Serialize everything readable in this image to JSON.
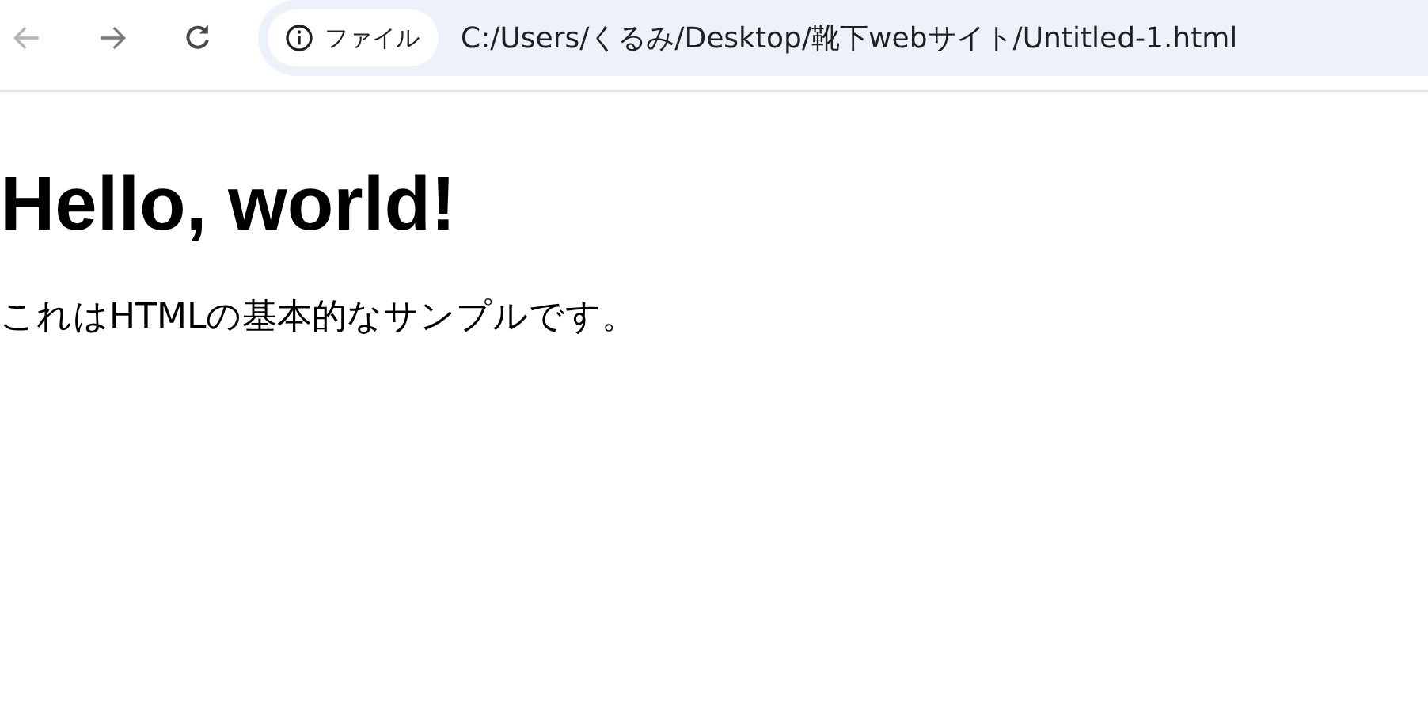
{
  "toolbar": {
    "back": {
      "disabled": true
    },
    "forward": {
      "disabled": false
    }
  },
  "address_bar": {
    "badge": "ファイル",
    "url": "C:/Users/くるみ/Desktop/靴下webサイト/Untitled-1.html"
  },
  "page": {
    "heading": "Hello, world!",
    "paragraph": "これはHTMLの基本的なサンプルです。"
  }
}
